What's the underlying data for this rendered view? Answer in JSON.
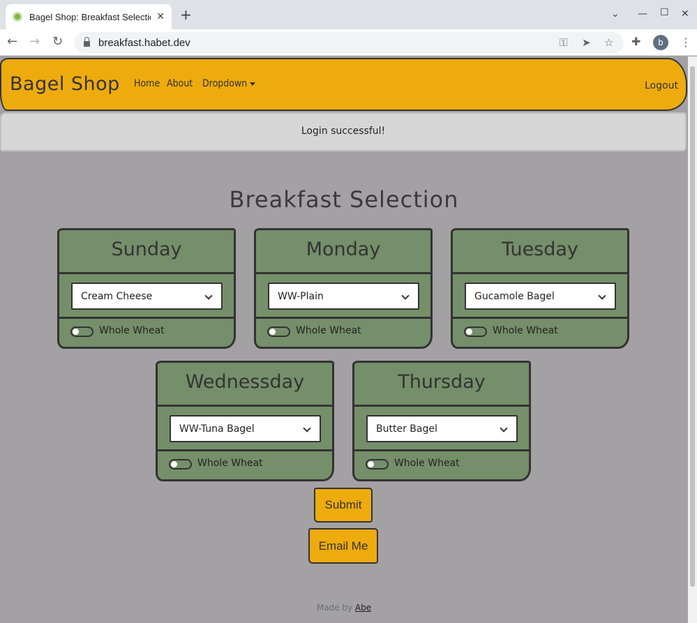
{
  "browser": {
    "tab_title": "Bagel Shop: Breakfast Selection",
    "tab_close": "✕",
    "new_tab": "+",
    "url": "breakfast.habet.dev",
    "profile_initial": "b"
  },
  "navbar": {
    "brand": "Bagel Shop",
    "links": [
      "Home",
      "About",
      "Dropdown"
    ],
    "logout": "Logout"
  },
  "alert": {
    "message": "Login successful!"
  },
  "page": {
    "heading": "Breakfast Selection"
  },
  "days": [
    {
      "name": "Sunday",
      "selection": "Cream Cheese",
      "toggle_label": "Whole Wheat"
    },
    {
      "name": "Monday",
      "selection": "WW-Plain",
      "toggle_label": "Whole Wheat"
    },
    {
      "name": "Tuesday",
      "selection": "Gucamole Bagel",
      "toggle_label": "Whole Wheat"
    },
    {
      "name": "Wednessday",
      "selection": "WW-Tuna Bagel",
      "toggle_label": "Whole Wheat"
    },
    {
      "name": "Thursday",
      "selection": "Butter Bagel",
      "toggle_label": "Whole Wheat"
    }
  ],
  "buttons": {
    "submit": "Submit",
    "email": "Email Me"
  },
  "footer": {
    "text": "Made by",
    "link": "Abe"
  },
  "colors": {
    "navbar": "#eeab0e",
    "card": "#758f6a",
    "background": "#a3a1a3"
  }
}
